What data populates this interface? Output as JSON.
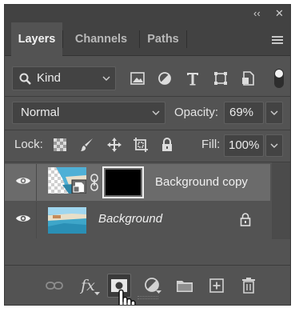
{
  "panel": {
    "collapse_glyph": "‹‹",
    "close_glyph": "✕",
    "tabs": [
      {
        "label": "Layers",
        "active": true
      },
      {
        "label": "Channels",
        "active": false
      },
      {
        "label": "Paths",
        "active": false
      }
    ],
    "menu_icon": "hamburger-menu-icon"
  },
  "filter": {
    "kind_label": "Kind",
    "filter_icons": [
      "pixel-layer-filter-icon",
      "adjustment-layer-filter-icon",
      "type-layer-filter-icon",
      "shape-layer-filter-icon",
      "smart-object-filter-icon"
    ],
    "toggle_state": "on"
  },
  "blend": {
    "mode": "Normal",
    "opacity_label": "Opacity:",
    "opacity_value": "69%"
  },
  "lock": {
    "label": "Lock:",
    "icons": [
      "lock-transparent-pixels-icon",
      "lock-image-pixels-icon",
      "lock-position-icon",
      "lock-artboard-icon",
      "lock-all-icon"
    ],
    "fill_label": "Fill:",
    "fill_value": "100%"
  },
  "layers": [
    {
      "name": "Background copy",
      "selected": true,
      "visible": true,
      "has_mask": true,
      "smart_object": true,
      "italic": false,
      "locked": false
    },
    {
      "name": "Background",
      "selected": false,
      "visible": true,
      "has_mask": false,
      "smart_object": false,
      "italic": true,
      "locked": true
    }
  ],
  "bottom_bar": {
    "fx_label": "fx",
    "icons": [
      "link-layers-icon",
      "layer-style-fx-icon",
      "add-layer-mask-icon",
      "new-fill-adjustment-icon",
      "new-group-folder-icon",
      "new-layer-icon",
      "delete-layer-icon"
    ],
    "active_icon": "add-layer-mask-icon"
  },
  "colors": {
    "panel_bg": "#535353",
    "header_bg": "#424242",
    "selected_layer": "#6b6b6b",
    "field_bg": "#434343"
  }
}
